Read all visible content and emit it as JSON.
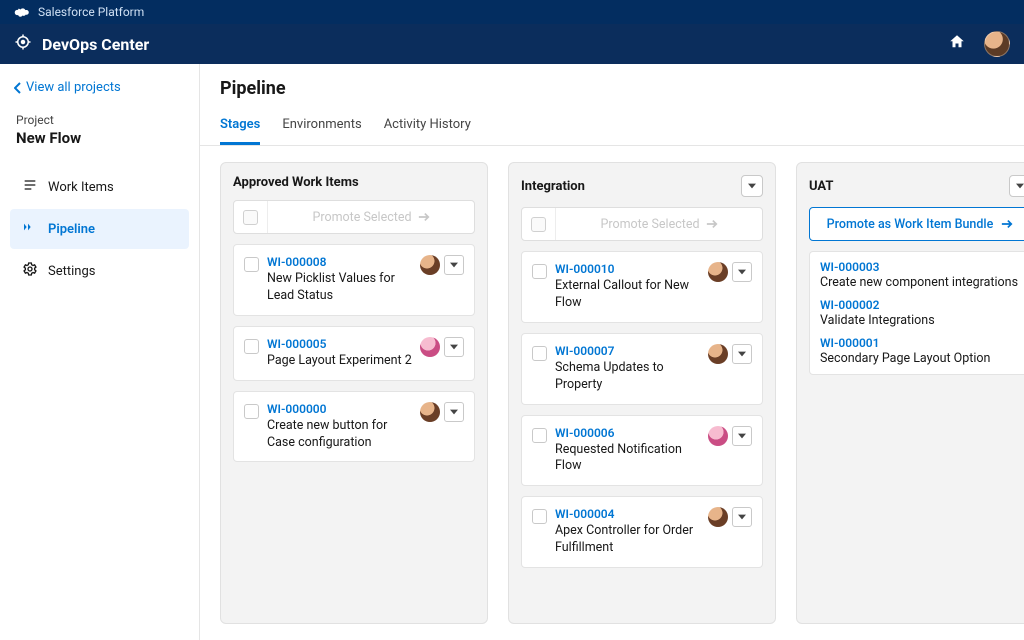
{
  "topbar": {
    "brand": "Salesforce Platform"
  },
  "header": {
    "app_title": "DevOps Center"
  },
  "sidebar": {
    "back_label": "View all projects",
    "project_label": "Project",
    "project_name": "New Flow",
    "nav": [
      {
        "key": "work-items",
        "label": "Work Items"
      },
      {
        "key": "pipeline",
        "label": "Pipeline"
      },
      {
        "key": "settings",
        "label": "Settings"
      }
    ],
    "active_nav": "pipeline"
  },
  "main": {
    "page_title": "Pipeline",
    "tabs": [
      "Stages",
      "Environments",
      "Activity History"
    ],
    "active_tab": "Stages"
  },
  "pipeline": {
    "promote_selected_label": "Promote Selected",
    "promote_bundle_label": "Promote as Work Item Bundle",
    "columns": [
      {
        "title": "Approved Work Items",
        "has_menu": false,
        "promote_type": "selected",
        "cards": [
          {
            "id": "WI-000008",
            "title": "New Picklist Values for Lead Status",
            "avatar": "default"
          },
          {
            "id": "WI-000005",
            "title": "Page Layout Experiment 2",
            "avatar": "pink"
          },
          {
            "id": "WI-000000",
            "title": "Create new button for Case configuration",
            "avatar": "default"
          }
        ]
      },
      {
        "title": "Integration",
        "has_menu": true,
        "promote_type": "selected",
        "cards": [
          {
            "id": "WI-000010",
            "title": "External Callout for New Flow",
            "avatar": "default"
          },
          {
            "id": "WI-000007",
            "title": "Schema Updates to Property",
            "avatar": "default"
          },
          {
            "id": "WI-000006",
            "title": "Requested Notification Flow",
            "avatar": "pink"
          },
          {
            "id": "WI-000004",
            "title": "Apex Controller for Order Fulfillment",
            "avatar": "default"
          }
        ]
      },
      {
        "title": "UAT",
        "has_menu": true,
        "promote_type": "bundle",
        "items": [
          {
            "id": "WI-000003",
            "title": "Create new component integrations"
          },
          {
            "id": "WI-000002",
            "title": "Validate Integrations"
          },
          {
            "id": "WI-000001",
            "title": "Secondary Page Layout Option"
          }
        ]
      }
    ]
  }
}
